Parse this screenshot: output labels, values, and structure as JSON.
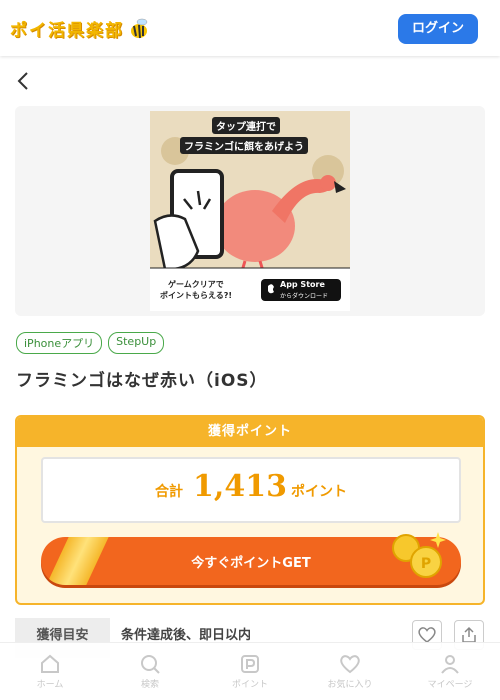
{
  "header": {
    "logo_text": "ポイ活県楽部",
    "login_label": "ログイン"
  },
  "banner": {
    "line1": "タップ連打で",
    "line2": "フラミンゴに餌をあげよう",
    "footer_left_1": "ゲームクリアで",
    "footer_left_2": "ポイントもらえる?!",
    "store_line1": "App Store",
    "store_line2": "からダウンロード"
  },
  "tags": [
    "iPhoneアプリ",
    "StepUp"
  ],
  "title": "フラミンゴはなぜ赤い（iOS）",
  "points": {
    "header": "獲得ポイント",
    "sum_label": "合計",
    "value": "1,413",
    "unit": "ポイント",
    "cta_label": "今すぐポイントGET"
  },
  "estimate": {
    "label": "獲得目安",
    "value": "条件達成後、即日以内"
  },
  "tabbar": [
    {
      "label": "ホーム",
      "icon": "home-icon"
    },
    {
      "label": "検索",
      "icon": "search-icon"
    },
    {
      "label": "ポイント",
      "icon": "point-icon"
    },
    {
      "label": "お気に入り",
      "icon": "heart-icon"
    },
    {
      "label": "マイページ",
      "icon": "user-icon"
    }
  ],
  "colors": {
    "accent": "#2b79e8",
    "orange": "#f2661e",
    "gold": "#f6b42a",
    "tag_green": "#4aa94a"
  }
}
